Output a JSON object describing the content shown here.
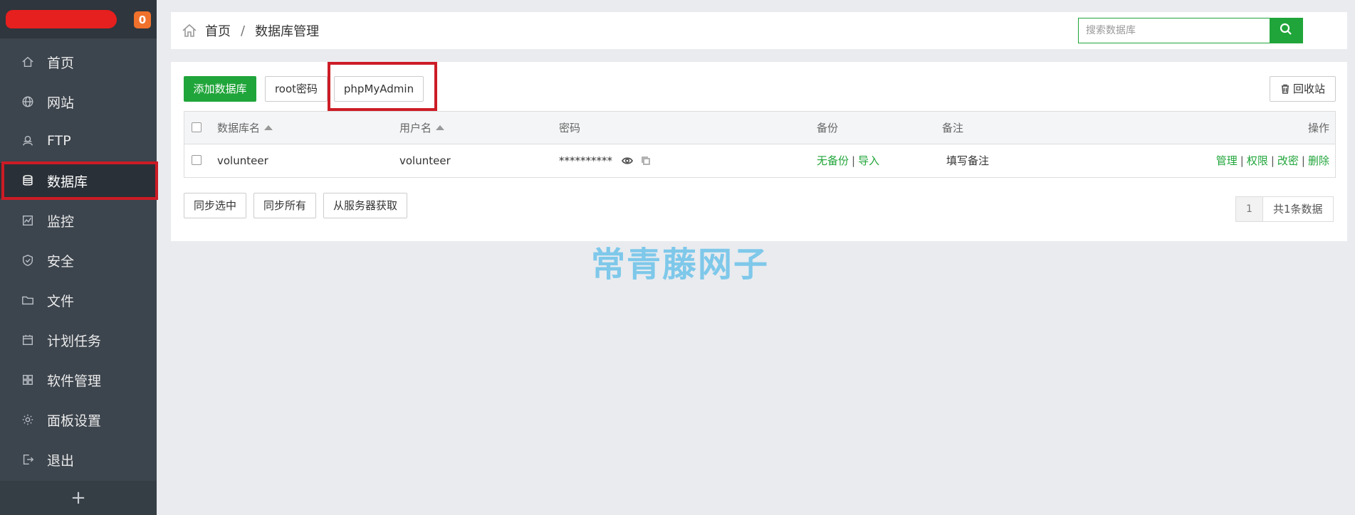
{
  "sidebar": {
    "badge": "0",
    "items": [
      {
        "label": "首页",
        "icon": "home-icon"
      },
      {
        "label": "网站",
        "icon": "globe-icon"
      },
      {
        "label": "FTP",
        "icon": "ftp-icon"
      },
      {
        "label": "数据库",
        "icon": "database-icon",
        "active": true
      },
      {
        "label": "监控",
        "icon": "monitor-icon"
      },
      {
        "label": "安全",
        "icon": "shield-icon"
      },
      {
        "label": "文件",
        "icon": "folder-icon"
      },
      {
        "label": "计划任务",
        "icon": "calendar-icon"
      },
      {
        "label": "软件管理",
        "icon": "apps-icon"
      },
      {
        "label": "面板设置",
        "icon": "gear-icon"
      },
      {
        "label": "退出",
        "icon": "logout-icon"
      }
    ],
    "add_label": "+"
  },
  "header": {
    "breadcrumb_home": "首页",
    "breadcrumb_sep": "/",
    "breadcrumb_current": "数据库管理",
    "search_placeholder": "搜索数据库"
  },
  "toolbar": {
    "add_db": "添加数据库",
    "root_password": "root密码",
    "phpmyadmin": "phpMyAdmin",
    "recycle_bin": "回收站"
  },
  "table": {
    "headers": {
      "db_name": "数据库名",
      "username": "用户名",
      "password": "密码",
      "backup": "备份",
      "remark": "备注",
      "actions": "操作"
    },
    "rows": [
      {
        "db_name": "volunteer",
        "username": "volunteer",
        "password": "**********",
        "backup_none": "无备份",
        "import": "导入",
        "remark": "填写备注",
        "act_manage": "管理",
        "act_perm": "权限",
        "act_changepw": "改密",
        "act_delete": "删除"
      }
    ]
  },
  "bottom_actions": {
    "sync_selected": "同步选中",
    "sync_all": "同步所有",
    "fetch_server": "从服务器获取"
  },
  "pagination": {
    "page": "1",
    "total": "共1条数据"
  },
  "watermark": "常青藤网子",
  "colors": {
    "accent": "#20a53a",
    "sidebar_bg": "#3c444d",
    "highlight_box": "#cc1c26",
    "badge": "#f0712b"
  }
}
